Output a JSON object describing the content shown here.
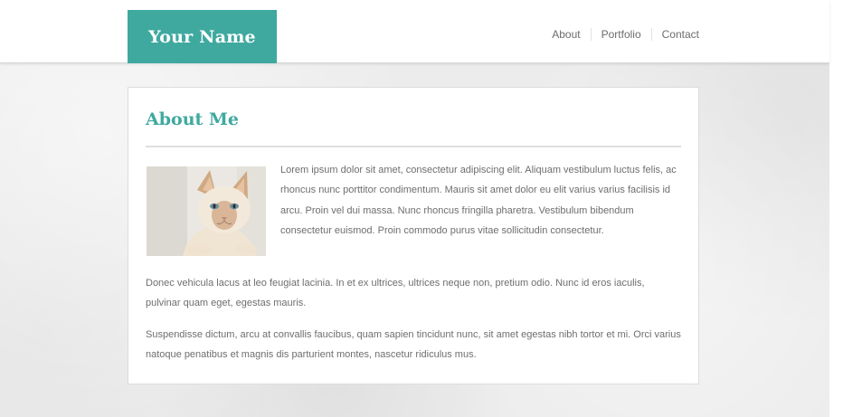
{
  "header": {
    "logo_text": "Your Name",
    "nav": [
      {
        "label": "About"
      },
      {
        "label": "Portfolio"
      },
      {
        "label": "Contact"
      }
    ]
  },
  "main": {
    "title": "About Me",
    "image_subject": "cat-photo",
    "paragraphs": [
      "Lorem ipsum dolor sit amet, consectetur adipiscing elit. Aliquam vestibulum luctus felis, ac rhoncus nunc porttitor condimentum. Mauris sit amet dolor eu elit varius varius facilisis id arcu. Proin vel dui massa. Nunc rhoncus fringilla pharetra. Vestibulum bibendum consectetur euismod. Proin commodo purus vitae sollicitudin consectetur.",
      "Donec vehicula lacus at leo feugiat lacinia. In et ex ultrices, ultrices neque non, pretium odio. Nunc id eros iaculis, pulvinar quam eget, egestas mauris.",
      "Suspendisse dictum, arcu at convallis faucibus, quam sapien tincidunt nunc, sit amet egestas nibh tortor et mi. Orci varius natoque penatibus et magnis dis parturient montes, nascetur ridiculus mus."
    ]
  },
  "colors": {
    "accent": "#3fa9a0",
    "text": "#6e6e6e",
    "nav_text": "#6c6c6c",
    "background": "#ececec"
  }
}
